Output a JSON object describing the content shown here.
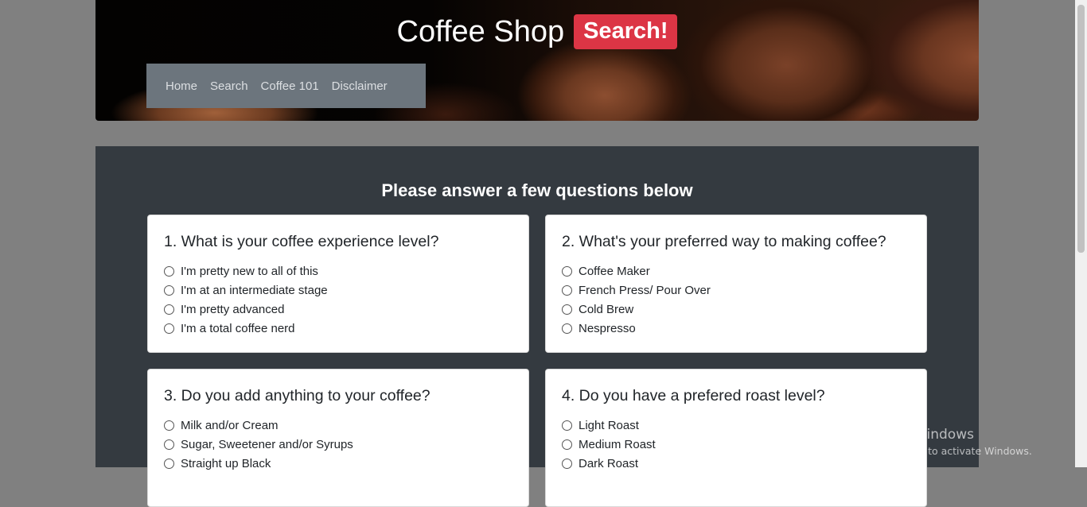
{
  "header": {
    "title": "Coffee Shop",
    "search_badge": "Search!",
    "nav": [
      "Home",
      "Search",
      "Coffee 101",
      "Disclaimer"
    ]
  },
  "main": {
    "heading": "Please answer a few questions below",
    "questions": [
      {
        "title": "1. What is your coffee experience level?",
        "options": [
          "I'm pretty new to all of this",
          "I'm at an intermediate stage",
          "I'm pretty advanced",
          "I'm a total coffee nerd"
        ]
      },
      {
        "title": "2. What's your preferred way to making coffee?",
        "options": [
          "Coffee Maker",
          "French Press/ Pour Over",
          "Cold Brew",
          "Nespresso"
        ]
      },
      {
        "title": "3. Do you add anything to your coffee?",
        "options": [
          "Milk and/or Cream",
          "Sugar, Sweetener and/or Syrups",
          "Straight up Black"
        ]
      },
      {
        "title": "4. Do you have a prefered roast level?",
        "options": [
          "Light Roast",
          "Medium Roast",
          "Dark Roast"
        ]
      }
    ]
  },
  "watermark": {
    "title": "Activate Windows",
    "subtitle": "Go to Settings to activate Windows."
  },
  "colors": {
    "page_bg": "#808080",
    "panel_bg": "#343a40",
    "nav_bg": "#6c757d",
    "badge_red": "#dc3545"
  }
}
